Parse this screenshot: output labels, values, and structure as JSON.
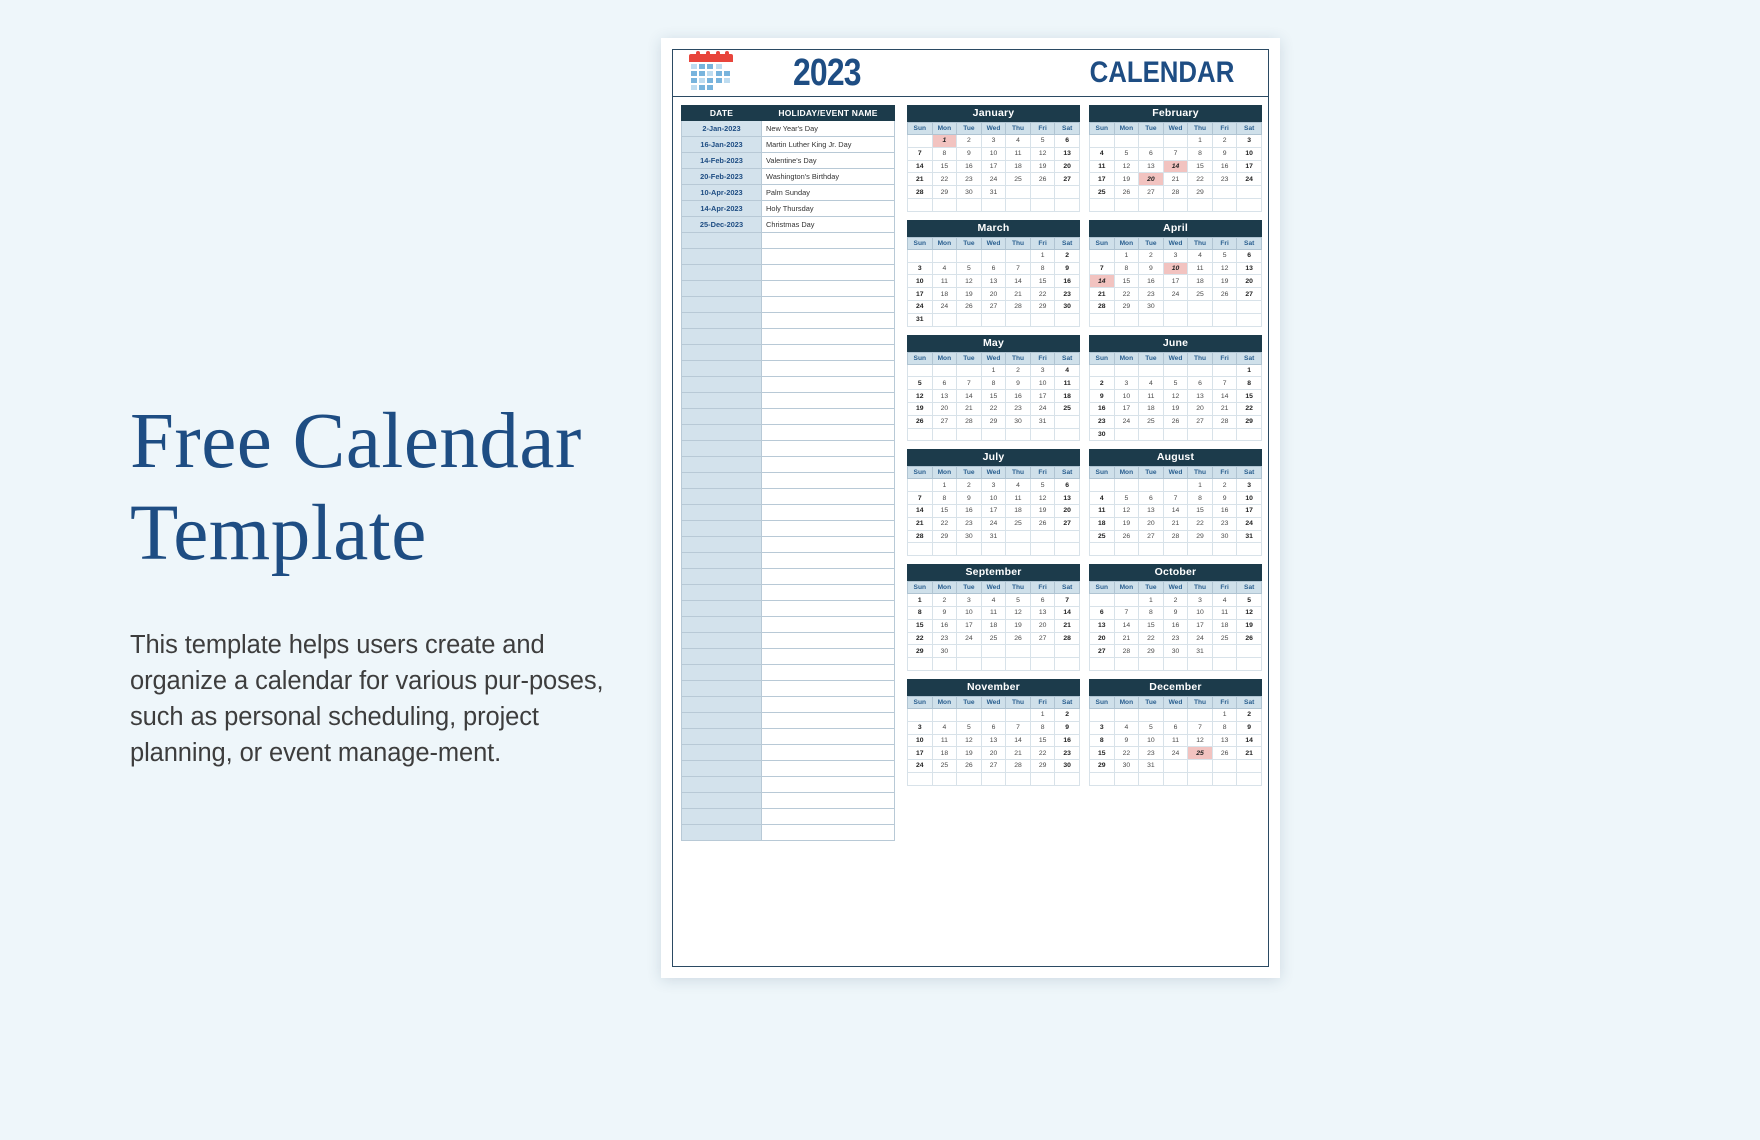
{
  "promo": {
    "title_line1": "Free Calendar",
    "title_line2": "Template",
    "description": "This template helps users create and organize a calendar for various pur-poses, such as personal scheduling, project planning, or event manage-ment."
  },
  "sheet": {
    "year": "2023",
    "calendar_word": "CALENDAR",
    "icon": "calendar-icon"
  },
  "events_table": {
    "headers": [
      "DATE",
      "HOLIDAY/EVENT NAME"
    ],
    "rows": [
      {
        "date": "2-Jan-2023",
        "name": "New Year's Day"
      },
      {
        "date": "16-Jan-2023",
        "name": "Martin Luther King Jr. Day"
      },
      {
        "date": "14-Feb-2023",
        "name": "Valentine's Day"
      },
      {
        "date": "20-Feb-2023",
        "name": "Washington's Birthday"
      },
      {
        "date": "10-Apr-2023",
        "name": "Palm Sunday"
      },
      {
        "date": "14-Apr-2023",
        "name": "Holy Thursday"
      },
      {
        "date": "25-Dec-2023",
        "name": "Christmas Day"
      }
    ],
    "empty_rows": 38
  },
  "weekday_headers": [
    "Sun",
    "Mon",
    "Tue",
    "Wed",
    "Thu",
    "Fri",
    "Sat"
  ],
  "colors": {
    "brand_blue": "#1e4d83",
    "header_dark": "#1c3b4b",
    "weekday_band": "#cfe0ea",
    "date_cell": "#d3e2ec",
    "highlight": "#f2c3c0",
    "page_bg": "#eef6fa"
  },
  "months": [
    {
      "name": "January",
      "weeks": [
        [
          "",
          "1",
          "2",
          "3",
          "4",
          "5",
          "6"
        ],
        [
          "7",
          "8",
          "9",
          "10",
          "11",
          "12",
          "13"
        ],
        [
          "14",
          "15",
          "16",
          "17",
          "18",
          "19",
          "20"
        ],
        [
          "21",
          "22",
          "23",
          "24",
          "25",
          "26",
          "27"
        ],
        [
          "28",
          "29",
          "30",
          "31",
          "",
          "",
          ""
        ],
        [
          "",
          "",
          "",
          "",
          "",
          "",
          ""
        ]
      ],
      "highlights": [
        "1"
      ]
    },
    {
      "name": "February",
      "weeks": [
        [
          "",
          "",
          "",
          "",
          "1",
          "2",
          "3"
        ],
        [
          "4",
          "5",
          "6",
          "7",
          "8",
          "9",
          "10"
        ],
        [
          "11",
          "12",
          "13",
          "14",
          "15",
          "16",
          "17"
        ],
        [
          "17",
          "19",
          "20",
          "21",
          "22",
          "23",
          "24"
        ],
        [
          "25",
          "26",
          "27",
          "28",
          "29",
          "",
          ""
        ],
        [
          "",
          "",
          "",
          "",
          "",
          "",
          ""
        ]
      ],
      "highlights": [
        "14",
        "20"
      ]
    },
    {
      "name": "March",
      "weeks": [
        [
          "",
          "",
          "",
          "",
          "",
          "1",
          "2"
        ],
        [
          "3",
          "4",
          "5",
          "6",
          "7",
          "8",
          "9"
        ],
        [
          "10",
          "11",
          "12",
          "13",
          "14",
          "15",
          "16"
        ],
        [
          "17",
          "18",
          "19",
          "20",
          "21",
          "22",
          "23"
        ],
        [
          "24",
          "24",
          "26",
          "27",
          "28",
          "29",
          "30"
        ],
        [
          "31",
          "",
          "",
          "",
          "",
          "",
          ""
        ]
      ],
      "highlights": []
    },
    {
      "name": "April",
      "weeks": [
        [
          "",
          "1",
          "2",
          "3",
          "4",
          "5",
          "6"
        ],
        [
          "7",
          "8",
          "9",
          "10",
          "11",
          "12",
          "13"
        ],
        [
          "14",
          "15",
          "16",
          "17",
          "18",
          "19",
          "20"
        ],
        [
          "21",
          "22",
          "23",
          "24",
          "25",
          "26",
          "27"
        ],
        [
          "28",
          "29",
          "30",
          "",
          "",
          "",
          ""
        ],
        [
          "",
          "",
          "",
          "",
          "",
          "",
          ""
        ]
      ],
      "highlights": [
        "10",
        "14"
      ]
    },
    {
      "name": "May",
      "weeks": [
        [
          "",
          "",
          "",
          "1",
          "2",
          "3",
          "4"
        ],
        [
          "5",
          "6",
          "7",
          "8",
          "9",
          "10",
          "11"
        ],
        [
          "12",
          "13",
          "14",
          "15",
          "16",
          "17",
          "18"
        ],
        [
          "19",
          "20",
          "21",
          "22",
          "23",
          "24",
          "25"
        ],
        [
          "26",
          "27",
          "28",
          "29",
          "30",
          "31",
          ""
        ],
        [
          "",
          "",
          "",
          "",
          "",
          "",
          ""
        ]
      ],
      "highlights": []
    },
    {
      "name": "June",
      "weeks": [
        [
          "",
          "",
          "",
          "",
          "",
          "",
          "1"
        ],
        [
          "2",
          "3",
          "4",
          "5",
          "6",
          "7",
          "8"
        ],
        [
          "9",
          "10",
          "11",
          "12",
          "13",
          "14",
          "15"
        ],
        [
          "16",
          "17",
          "18",
          "19",
          "20",
          "21",
          "22"
        ],
        [
          "23",
          "24",
          "25",
          "26",
          "27",
          "28",
          "29"
        ],
        [
          "30",
          "",
          "",
          "",
          "",
          "",
          ""
        ]
      ],
      "highlights": []
    },
    {
      "name": "July",
      "weeks": [
        [
          "",
          "1",
          "2",
          "3",
          "4",
          "5",
          "6"
        ],
        [
          "7",
          "8",
          "9",
          "10",
          "11",
          "12",
          "13"
        ],
        [
          "14",
          "15",
          "16",
          "17",
          "18",
          "19",
          "20"
        ],
        [
          "21",
          "22",
          "23",
          "24",
          "25",
          "26",
          "27"
        ],
        [
          "28",
          "29",
          "30",
          "31",
          "",
          "",
          ""
        ],
        [
          "",
          "",
          "",
          "",
          "",
          "",
          ""
        ]
      ],
      "highlights": []
    },
    {
      "name": "August",
      "weeks": [
        [
          "",
          "",
          "",
          "",
          "1",
          "2",
          "3"
        ],
        [
          "4",
          "5",
          "6",
          "7",
          "8",
          "9",
          "10"
        ],
        [
          "11",
          "12",
          "13",
          "14",
          "15",
          "16",
          "17"
        ],
        [
          "18",
          "19",
          "20",
          "21",
          "22",
          "23",
          "24"
        ],
        [
          "25",
          "26",
          "27",
          "28",
          "29",
          "30",
          "31"
        ],
        [
          "",
          "",
          "",
          "",
          "",
          "",
          ""
        ]
      ],
      "highlights": []
    },
    {
      "name": "September",
      "weeks": [
        [
          "1",
          "2",
          "3",
          "4",
          "5",
          "6",
          "7"
        ],
        [
          "8",
          "9",
          "10",
          "11",
          "12",
          "13",
          "14"
        ],
        [
          "15",
          "16",
          "17",
          "18",
          "19",
          "20",
          "21"
        ],
        [
          "22",
          "23",
          "24",
          "25",
          "26",
          "27",
          "28"
        ],
        [
          "29",
          "30",
          "",
          "",
          "",
          "",
          ""
        ],
        [
          "",
          "",
          "",
          "",
          "",
          "",
          ""
        ]
      ],
      "highlights": []
    },
    {
      "name": "October",
      "weeks": [
        [
          "",
          "",
          "1",
          "2",
          "3",
          "4",
          "5"
        ],
        [
          "6",
          "7",
          "8",
          "9",
          "10",
          "11",
          "12"
        ],
        [
          "13",
          "14",
          "15",
          "16",
          "17",
          "18",
          "19"
        ],
        [
          "20",
          "21",
          "22",
          "23",
          "24",
          "25",
          "26"
        ],
        [
          "27",
          "28",
          "29",
          "30",
          "31",
          "",
          ""
        ],
        [
          "",
          "",
          "",
          "",
          "",
          "",
          ""
        ]
      ],
      "highlights": []
    },
    {
      "name": "November",
      "weeks": [
        [
          "",
          "",
          "",
          "",
          "",
          "1",
          "2"
        ],
        [
          "3",
          "4",
          "5",
          "6",
          "7",
          "8",
          "9"
        ],
        [
          "10",
          "11",
          "12",
          "13",
          "14",
          "15",
          "16"
        ],
        [
          "17",
          "18",
          "19",
          "20",
          "21",
          "22",
          "23"
        ],
        [
          "24",
          "25",
          "26",
          "27",
          "28",
          "29",
          "30"
        ],
        [
          "",
          "",
          "",
          "",
          "",
          "",
          ""
        ]
      ],
      "highlights": []
    },
    {
      "name": "December",
      "weeks": [
        [
          "",
          "",
          "",
          "",
          "",
          "1",
          "2"
        ],
        [
          "3",
          "4",
          "5",
          "6",
          "7",
          "8",
          "9"
        ],
        [
          "8",
          "9",
          "10",
          "11",
          "12",
          "13",
          "14"
        ],
        [
          "15",
          "22",
          "23",
          "24",
          "25",
          "26",
          "21"
        ],
        [
          "29",
          "30",
          "31",
          "",
          "",
          "",
          ""
        ],
        [
          "",
          "",
          "",
          "",
          "",
          "",
          ""
        ]
      ],
      "highlights": [
        "25"
      ]
    }
  ]
}
